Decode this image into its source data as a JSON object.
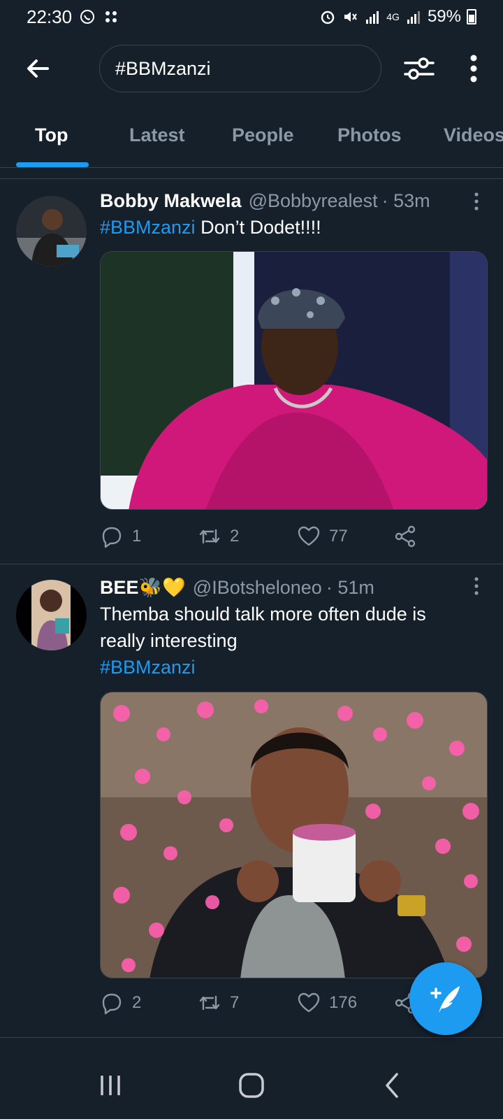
{
  "status_bar": {
    "time": "22:30",
    "battery": "59%",
    "network": "4G"
  },
  "search": {
    "value": "#BBMzanzi"
  },
  "tabs": [
    {
      "label": "Top",
      "active": true
    },
    {
      "label": "Latest",
      "active": false
    },
    {
      "label": "People",
      "active": false
    },
    {
      "label": "Photos",
      "active": false
    },
    {
      "label": "Videos",
      "active": false
    }
  ],
  "tweets": [
    {
      "name": "Bobby Makwela",
      "handle": "@Bobbyrealest",
      "time": "· 53m",
      "hashtag": "#BBMzanzi",
      "text": "Don’t Dodet!!!!",
      "replies": "1",
      "retweets": "2",
      "likes": "77"
    },
    {
      "name": "BEE",
      "emoji": "🐝💛",
      "handle": "@IBotsheloneo",
      "time": "· 51m",
      "text_line1": "Themba should talk more often dude is",
      "text_line2": "really interesting",
      "hashtag": "#BBMzanzi",
      "replies": "2",
      "retweets": "7",
      "likes": "176"
    }
  ],
  "colors": {
    "background": "#15202b",
    "accent": "#1d9bf0",
    "secondary_text": "#8b98a5",
    "border": "#38444d"
  }
}
